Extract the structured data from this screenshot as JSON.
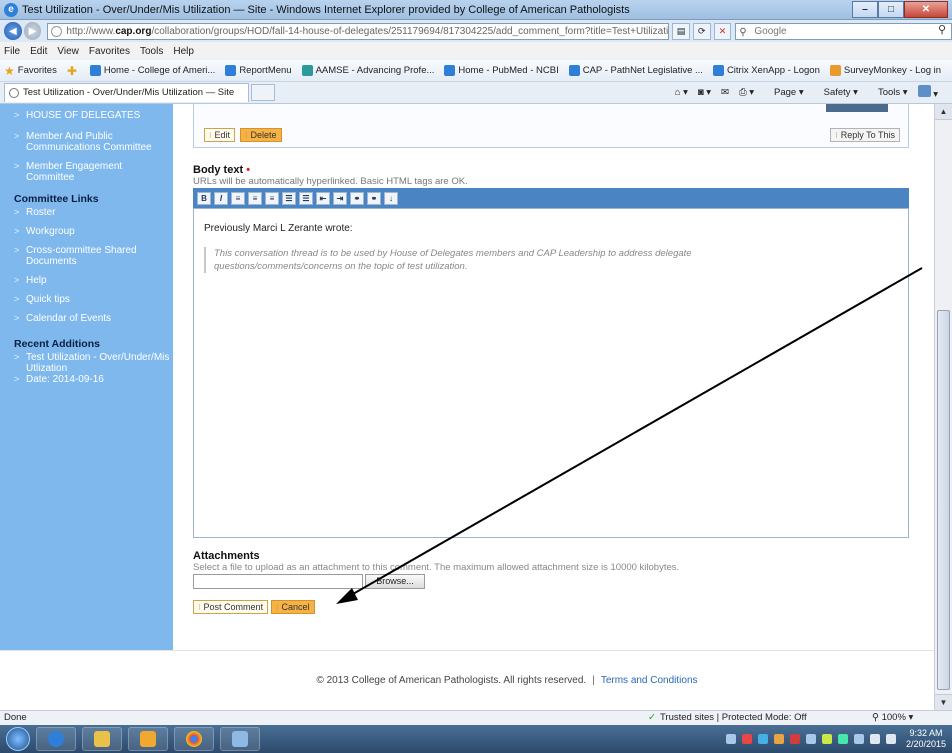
{
  "window": {
    "title": "Test Utilization - Over/Under/Mis Utilization — Site - Windows Internet Explorer provided by College of American Pathologists"
  },
  "address": {
    "url_prefix": "http://www.",
    "url_domain": "cap.org",
    "url_rest": "/collaboration/groups/HOD/fall-14-house-of-delegates/251179694/817304225/add_comment_form?title=Test+Utilization+-+Over",
    "search_placeholder": "Google"
  },
  "menu": [
    "File",
    "Edit",
    "View",
    "Favorites",
    "Tools",
    "Help"
  ],
  "favorites": {
    "label": "Favorites",
    "items": [
      "Home - College of Ameri...",
      "ReportMenu",
      "AAMSE - Advancing Profe...",
      "Home - PubMed - NCBI",
      "CAP - PathNet Legislative ...",
      "Citrix XenApp - Logon",
      "SurveyMonkey - Log in"
    ]
  },
  "tab": {
    "label": "Test Utilization - Over/Under/Mis Utilization — Site"
  },
  "commandbar": {
    "page": "Page",
    "safety": "Safety",
    "tools": "Tools"
  },
  "sidebar": {
    "items": [
      "HOUSE OF DELEGATES",
      "Member And Public Communications Committee",
      "Member Engagement Committee"
    ],
    "committee_heading": "Committee Links",
    "committee_links": [
      "Roster",
      "Workgroup",
      "Cross-committee Shared Documents",
      "Help",
      "Quick tips",
      "Calendar of Events"
    ],
    "recent_heading": "Recent Additions",
    "recent_item": "Test Utilization - Over/Under/Mis Utlization",
    "recent_date": "Date: 2014-09-16"
  },
  "comment": {
    "edit_label": "Edit",
    "delete_label": "Delete",
    "reply_label": "Reply To This"
  },
  "form": {
    "body_label": "Body text",
    "required_mark": "•",
    "body_help": "URLs will be automatically hyperlinked. Basic HTML tags are OK.",
    "toolbar_buttons": [
      "B",
      "I",
      "≡",
      "≡",
      "≡",
      "☰",
      "☰",
      "⇤",
      "⇥",
      "⚭",
      "⚭",
      "↓"
    ],
    "prev_wrote": "Previously Marci L Zerante wrote:",
    "quote": "This conversation thread is to be used by House of Delegates members and CAP Leadership to address delegate questions/comments/concerns on the topic of test utilization.",
    "attach_label": "Attachments",
    "attach_help": "Select a file to upload as an attachment to this comment. The maximum allowed attachment size is 10000 kilobytes.",
    "browse_label": "Browse...",
    "post_label": "Post Comment",
    "cancel_label": "Cancel"
  },
  "footer": {
    "copyright": "© 2013 College of American Pathologists. All rights reserved.",
    "separator": "|",
    "terms_link": "Terms and Conditions"
  },
  "status": {
    "left": "Done",
    "security": "Trusted sites | Protected Mode: Off",
    "zoom": "100%"
  },
  "taskbar": {
    "time": "9:32 AM",
    "date": "2/20/2015"
  }
}
